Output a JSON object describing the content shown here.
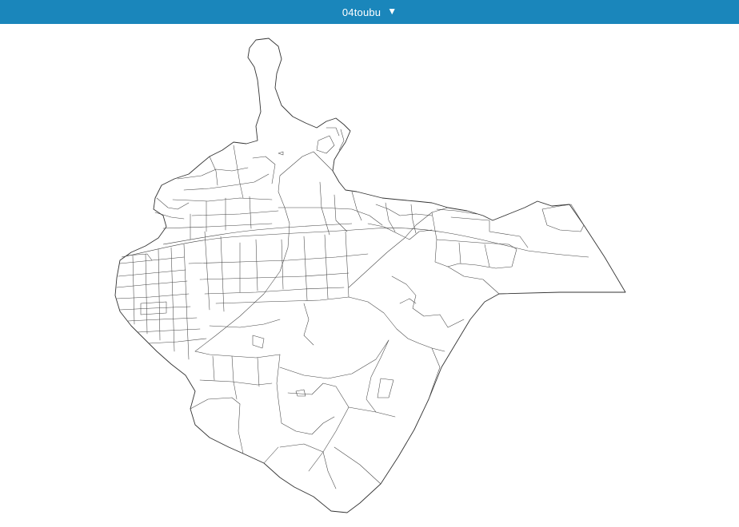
{
  "header": {
    "layer_name": "04toubu",
    "dropdown_icon": "triangle-down-icon",
    "background_color": "#1a86bb",
    "text_color": "#ffffff"
  },
  "map": {
    "line_color": "#444444",
    "fill_color": "#ffffff"
  }
}
